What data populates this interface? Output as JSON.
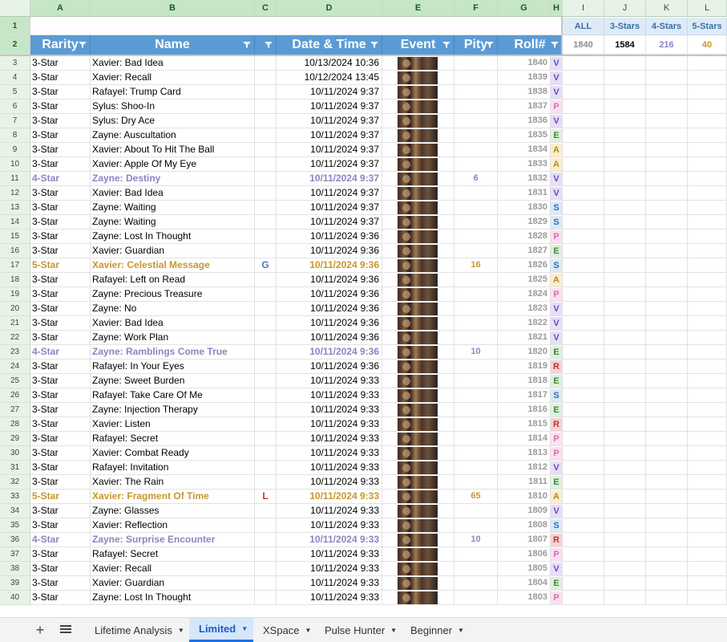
{
  "columns": [
    "A",
    "B",
    "C",
    "D",
    "E",
    "F",
    "G",
    "H",
    "I",
    "J",
    "K",
    "L"
  ],
  "table_headers": {
    "rarity": "Rarity",
    "name": "Name",
    "c": "",
    "date": "Date & Time",
    "event": "Event",
    "pity": "Pity",
    "roll": "Roll#"
  },
  "stats": {
    "labels": [
      "ALL",
      "3-Stars",
      "4-Stars",
      "5-Stars"
    ],
    "values": [
      "1840",
      "1584",
      "216",
      "40"
    ],
    "colors": [
      "#8c8c8c",
      "#000000",
      "#8b84c4",
      "#c8962e"
    ]
  },
  "letter_colors": {
    "V": "#6a4db5",
    "P": "#d66fb0",
    "E": "#3c8a3c",
    "A": "#b3882a",
    "S": "#2f6fb5",
    "R": "#b23a3a"
  },
  "letter_bg": {
    "V": "#e6defa",
    "P": "#fbe1f0",
    "E": "#dff0df",
    "A": "#fbeecb",
    "S": "#dce9f7",
    "R": "#f6d2d2"
  },
  "rows": [
    {
      "n": "3",
      "rarity": "3-Star",
      "name": "Xavier: Bad Idea",
      "tag": "",
      "date": "10/13/2024 10:36",
      "pity": "",
      "roll": "1840",
      "code": "V",
      "tier": "3"
    },
    {
      "n": "4",
      "rarity": "3-Star",
      "name": "Xavier: Recall",
      "tag": "",
      "date": "10/12/2024 13:45",
      "pity": "",
      "roll": "1839",
      "code": "V",
      "tier": "3"
    },
    {
      "n": "5",
      "rarity": "3-Star",
      "name": "Rafayel: Trump Card",
      "tag": "",
      "date": "10/11/2024 9:37",
      "pity": "",
      "roll": "1838",
      "code": "V",
      "tier": "3"
    },
    {
      "n": "6",
      "rarity": "3-Star",
      "name": "Sylus: Shoo-In",
      "tag": "",
      "date": "10/11/2024 9:37",
      "pity": "",
      "roll": "1837",
      "code": "P",
      "tier": "3"
    },
    {
      "n": "7",
      "rarity": "3-Star",
      "name": "Sylus: Dry Ace",
      "tag": "",
      "date": "10/11/2024 9:37",
      "pity": "",
      "roll": "1836",
      "code": "V",
      "tier": "3"
    },
    {
      "n": "8",
      "rarity": "3-Star",
      "name": "Zayne: Auscultation",
      "tag": "",
      "date": "10/11/2024 9:37",
      "pity": "",
      "roll": "1835",
      "code": "E",
      "tier": "3"
    },
    {
      "n": "9",
      "rarity": "3-Star",
      "name": "Xavier: About To Hit The Ball",
      "tag": "",
      "date": "10/11/2024 9:37",
      "pity": "",
      "roll": "1834",
      "code": "A",
      "tier": "3"
    },
    {
      "n": "10",
      "rarity": "3-Star",
      "name": "Xavier: Apple Of My Eye",
      "tag": "",
      "date": "10/11/2024 9:37",
      "pity": "",
      "roll": "1833",
      "code": "A",
      "tier": "3"
    },
    {
      "n": "11",
      "rarity": "4-Star",
      "name": "Zayne: Destiny",
      "tag": "",
      "date": "10/11/2024 9:37",
      "pity": "6",
      "roll": "1832",
      "code": "V",
      "tier": "4"
    },
    {
      "n": "12",
      "rarity": "3-Star",
      "name": "Xavier: Bad Idea",
      "tag": "",
      "date": "10/11/2024 9:37",
      "pity": "",
      "roll": "1831",
      "code": "V",
      "tier": "3"
    },
    {
      "n": "13",
      "rarity": "3-Star",
      "name": "Zayne: Waiting",
      "tag": "",
      "date": "10/11/2024 9:37",
      "pity": "",
      "roll": "1830",
      "code": "S",
      "tier": "3"
    },
    {
      "n": "14",
      "rarity": "3-Star",
      "name": "Zayne: Waiting",
      "tag": "",
      "date": "10/11/2024 9:37",
      "pity": "",
      "roll": "1829",
      "code": "S",
      "tier": "3"
    },
    {
      "n": "15",
      "rarity": "3-Star",
      "name": "Zayne: Lost In Thought",
      "tag": "",
      "date": "10/11/2024 9:36",
      "pity": "",
      "roll": "1828",
      "code": "P",
      "tier": "3"
    },
    {
      "n": "16",
      "rarity": "3-Star",
      "name": "Xavier: Guardian",
      "tag": "",
      "date": "10/11/2024 9:36",
      "pity": "",
      "roll": "1827",
      "code": "E",
      "tier": "3"
    },
    {
      "n": "17",
      "rarity": "5-Star",
      "name": "Xavier: Celestial Message",
      "tag": "G",
      "date": "10/11/2024 9:36",
      "pity": "16",
      "roll": "1826",
      "code": "S",
      "tier": "5"
    },
    {
      "n": "18",
      "rarity": "3-Star",
      "name": "Rafayel: Left on Read",
      "tag": "",
      "date": "10/11/2024 9:36",
      "pity": "",
      "roll": "1825",
      "code": "A",
      "tier": "3"
    },
    {
      "n": "19",
      "rarity": "3-Star",
      "name": "Zayne: Precious Treasure",
      "tag": "",
      "date": "10/11/2024 9:36",
      "pity": "",
      "roll": "1824",
      "code": "P",
      "tier": "3"
    },
    {
      "n": "20",
      "rarity": "3-Star",
      "name": "Zayne: No",
      "tag": "",
      "date": "10/11/2024 9:36",
      "pity": "",
      "roll": "1823",
      "code": "V",
      "tier": "3"
    },
    {
      "n": "21",
      "rarity": "3-Star",
      "name": "Xavier: Bad Idea",
      "tag": "",
      "date": "10/11/2024 9:36",
      "pity": "",
      "roll": "1822",
      "code": "V",
      "tier": "3"
    },
    {
      "n": "22",
      "rarity": "3-Star",
      "name": "Zayne: Work Plan",
      "tag": "",
      "date": "10/11/2024 9:36",
      "pity": "",
      "roll": "1821",
      "code": "V",
      "tier": "3"
    },
    {
      "n": "23",
      "rarity": "4-Star",
      "name": "Zayne: Ramblings Come True",
      "tag": "",
      "date": "10/11/2024 9:36",
      "pity": "10",
      "roll": "1820",
      "code": "E",
      "tier": "4"
    },
    {
      "n": "24",
      "rarity": "3-Star",
      "name": "Rafayel: In Your Eyes",
      "tag": "",
      "date": "10/11/2024 9:36",
      "pity": "",
      "roll": "1819",
      "code": "R",
      "tier": "3"
    },
    {
      "n": "25",
      "rarity": "3-Star",
      "name": "Zayne: Sweet Burden",
      "tag": "",
      "date": "10/11/2024 9:33",
      "pity": "",
      "roll": "1818",
      "code": "E",
      "tier": "3"
    },
    {
      "n": "26",
      "rarity": "3-Star",
      "name": "Rafayel: Take Care Of Me",
      "tag": "",
      "date": "10/11/2024 9:33",
      "pity": "",
      "roll": "1817",
      "code": "S",
      "tier": "3"
    },
    {
      "n": "27",
      "rarity": "3-Star",
      "name": "Zayne: Injection Therapy",
      "tag": "",
      "date": "10/11/2024 9:33",
      "pity": "",
      "roll": "1816",
      "code": "E",
      "tier": "3"
    },
    {
      "n": "28",
      "rarity": "3-Star",
      "name": "Xavier: Listen",
      "tag": "",
      "date": "10/11/2024 9:33",
      "pity": "",
      "roll": "1815",
      "code": "R",
      "tier": "3"
    },
    {
      "n": "29",
      "rarity": "3-Star",
      "name": "Rafayel: Secret",
      "tag": "",
      "date": "10/11/2024 9:33",
      "pity": "",
      "roll": "1814",
      "code": "P",
      "tier": "3"
    },
    {
      "n": "30",
      "rarity": "3-Star",
      "name": "Xavier: Combat Ready",
      "tag": "",
      "date": "10/11/2024 9:33",
      "pity": "",
      "roll": "1813",
      "code": "P",
      "tier": "3"
    },
    {
      "n": "31",
      "rarity": "3-Star",
      "name": "Rafayel: Invitation",
      "tag": "",
      "date": "10/11/2024 9:33",
      "pity": "",
      "roll": "1812",
      "code": "V",
      "tier": "3"
    },
    {
      "n": "32",
      "rarity": "3-Star",
      "name": "Xavier: The Rain",
      "tag": "",
      "date": "10/11/2024 9:33",
      "pity": "",
      "roll": "1811",
      "code": "E",
      "tier": "3"
    },
    {
      "n": "33",
      "rarity": "5-Star",
      "name": "Xavier: Fragment Of Time",
      "tag": "L",
      "date": "10/11/2024 9:33",
      "pity": "65",
      "roll": "1810",
      "code": "A",
      "tier": "5"
    },
    {
      "n": "34",
      "rarity": "3-Star",
      "name": "Zayne: Glasses",
      "tag": "",
      "date": "10/11/2024 9:33",
      "pity": "",
      "roll": "1809",
      "code": "V",
      "tier": "3"
    },
    {
      "n": "35",
      "rarity": "3-Star",
      "name": "Xavier: Reflection",
      "tag": "",
      "date": "10/11/2024 9:33",
      "pity": "",
      "roll": "1808",
      "code": "S",
      "tier": "3"
    },
    {
      "n": "36",
      "rarity": "4-Star",
      "name": "Zayne: Surprise Encounter",
      "tag": "",
      "date": "10/11/2024 9:33",
      "pity": "10",
      "roll": "1807",
      "code": "R",
      "tier": "4"
    },
    {
      "n": "37",
      "rarity": "3-Star",
      "name": "Rafayel: Secret",
      "tag": "",
      "date": "10/11/2024 9:33",
      "pity": "",
      "roll": "1806",
      "code": "P",
      "tier": "3"
    },
    {
      "n": "38",
      "rarity": "3-Star",
      "name": "Xavier: Recall",
      "tag": "",
      "date": "10/11/2024 9:33",
      "pity": "",
      "roll": "1805",
      "code": "V",
      "tier": "3"
    },
    {
      "n": "39",
      "rarity": "3-Star",
      "name": "Xavier: Guardian",
      "tag": "",
      "date": "10/11/2024 9:33",
      "pity": "",
      "roll": "1804",
      "code": "E",
      "tier": "3"
    },
    {
      "n": "40",
      "rarity": "3-Star",
      "name": "Zayne: Lost In Thought",
      "tag": "",
      "date": "10/11/2024 9:33",
      "pity": "",
      "roll": "1803",
      "code": "P",
      "tier": "3"
    }
  ],
  "tabs": [
    {
      "label": "Lifetime Analysis",
      "active": false
    },
    {
      "label": "Limited",
      "active": true
    },
    {
      "label": "XSpace",
      "active": false
    },
    {
      "label": "Pulse Hunter",
      "active": false
    },
    {
      "label": "Beginner",
      "active": false
    }
  ],
  "icons": {
    "add": "plus-icon",
    "all_sheets": "menu-icon",
    "filter": "filter-icon",
    "dropdown": "caret-down-icon"
  }
}
